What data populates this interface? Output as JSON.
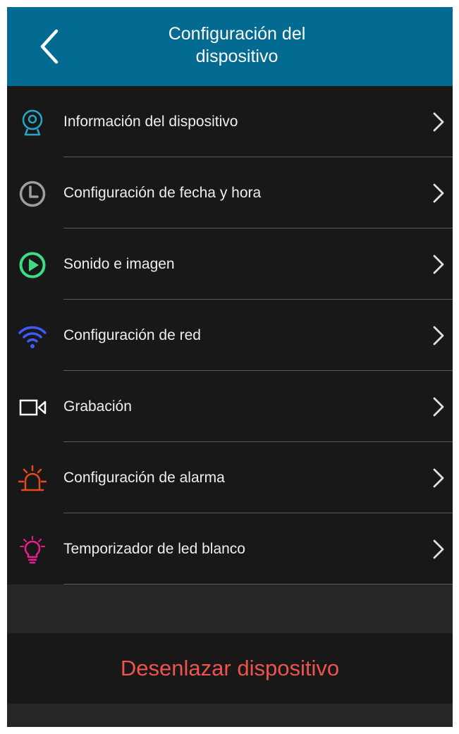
{
  "header": {
    "title_line1": "Configuración del",
    "title_line2": "dispositivo",
    "back_icon": "chevron-left-icon",
    "background": "#036a92"
  },
  "menu": {
    "items": [
      {
        "label": "Información del dispositivo",
        "icon": "camera-icon",
        "color": "#26a6c9"
      },
      {
        "label": "Configuración de fecha y hora",
        "icon": "clock-icon",
        "color": "#9e9e9e"
      },
      {
        "label": "Sonido e imagen",
        "icon": "play-icon",
        "color": "#3ddc84"
      },
      {
        "label": "Configuración de red",
        "icon": "wifi-icon",
        "color": "#3d5afe"
      },
      {
        "label": "Grabación",
        "icon": "video-camera-icon",
        "color": "#ffffff"
      },
      {
        "label": "Configuración de alarma",
        "icon": "alarm-siren-icon",
        "color": "#e64a19"
      },
      {
        "label": "Temporizador de led blanco",
        "icon": "light-bulb-icon",
        "color": "#e91e8c"
      }
    ],
    "chevron_icon": "chevron-right-icon"
  },
  "actions": {
    "unlink_label": "Desenlazar dispositivo",
    "unlink_color": "#ef5350"
  }
}
